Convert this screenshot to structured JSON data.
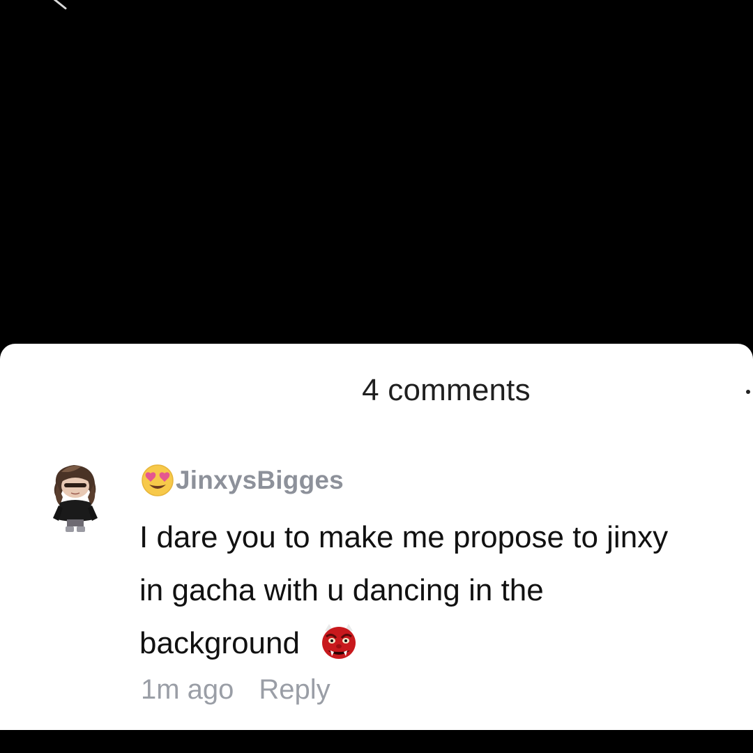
{
  "sheet": {
    "comment_count_label": "4 comments"
  },
  "comments": [
    {
      "author": "JinxysBigges",
      "author_emoji": "heart-eyes-emoji",
      "text": "I dare you to make me propose to jinxy in gacha with u dancing in the background",
      "trailing_emoji": "ogre-emoji",
      "time": "1m ago",
      "reply_label": "Reply"
    }
  ],
  "colors": {
    "background": "#000000",
    "sheet": "#ffffff",
    "author": "#8d919a",
    "body_text": "#111111",
    "meta_text": "#9a9ea6"
  }
}
